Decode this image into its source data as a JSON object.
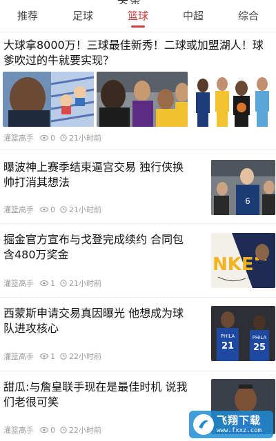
{
  "top_fragment": "头条",
  "tabs": [
    {
      "label": "推荐",
      "active": false
    },
    {
      "label": "足球",
      "active": false
    },
    {
      "label": "篮球",
      "active": true
    },
    {
      "label": "中超",
      "active": false
    },
    {
      "label": "综合",
      "active": false
    }
  ],
  "articles": [
    {
      "title_line1": "大球拿8000万！三球最佳新秀！二球或加盟湖人！球",
      "title_line2": "爹吹过的牛就要实现？",
      "author": "灌篮高手",
      "comments": "0",
      "time": "21小时前"
    },
    {
      "title_line1": "曝波神上赛季结束逼宫交易 独行侠换",
      "title_line2": "帅打消其想法",
      "author": "灌篮高手",
      "comments": "0",
      "time": "21小时前"
    },
    {
      "title_line1": "掘金官方宣布与戈登完成续约 合同包",
      "title_line2": "含480万奖金",
      "author": "灌篮高手",
      "comments": "1",
      "time": "21小时前"
    },
    {
      "title_line1": "西蒙斯申请交易真因曝光 他想成为球",
      "title_line2": "队进攻核心",
      "author": "灌篮高手",
      "comments": "1",
      "time": "22小时前"
    },
    {
      "title_line1": "甜瓜:与詹皇联手现在是最佳时机 说我",
      "title_line2": "们老很可笑",
      "author": "灌篮高手",
      "comments": "0",
      "time": "22小时前"
    }
  ],
  "thumb_text": {
    "jersey_21": "21",
    "jersey_25": "25",
    "phila": "PHILA",
    "nked": "NKED"
  },
  "watermark": {
    "text": "飞翔下载",
    "url": "www.fxxz.com"
  }
}
